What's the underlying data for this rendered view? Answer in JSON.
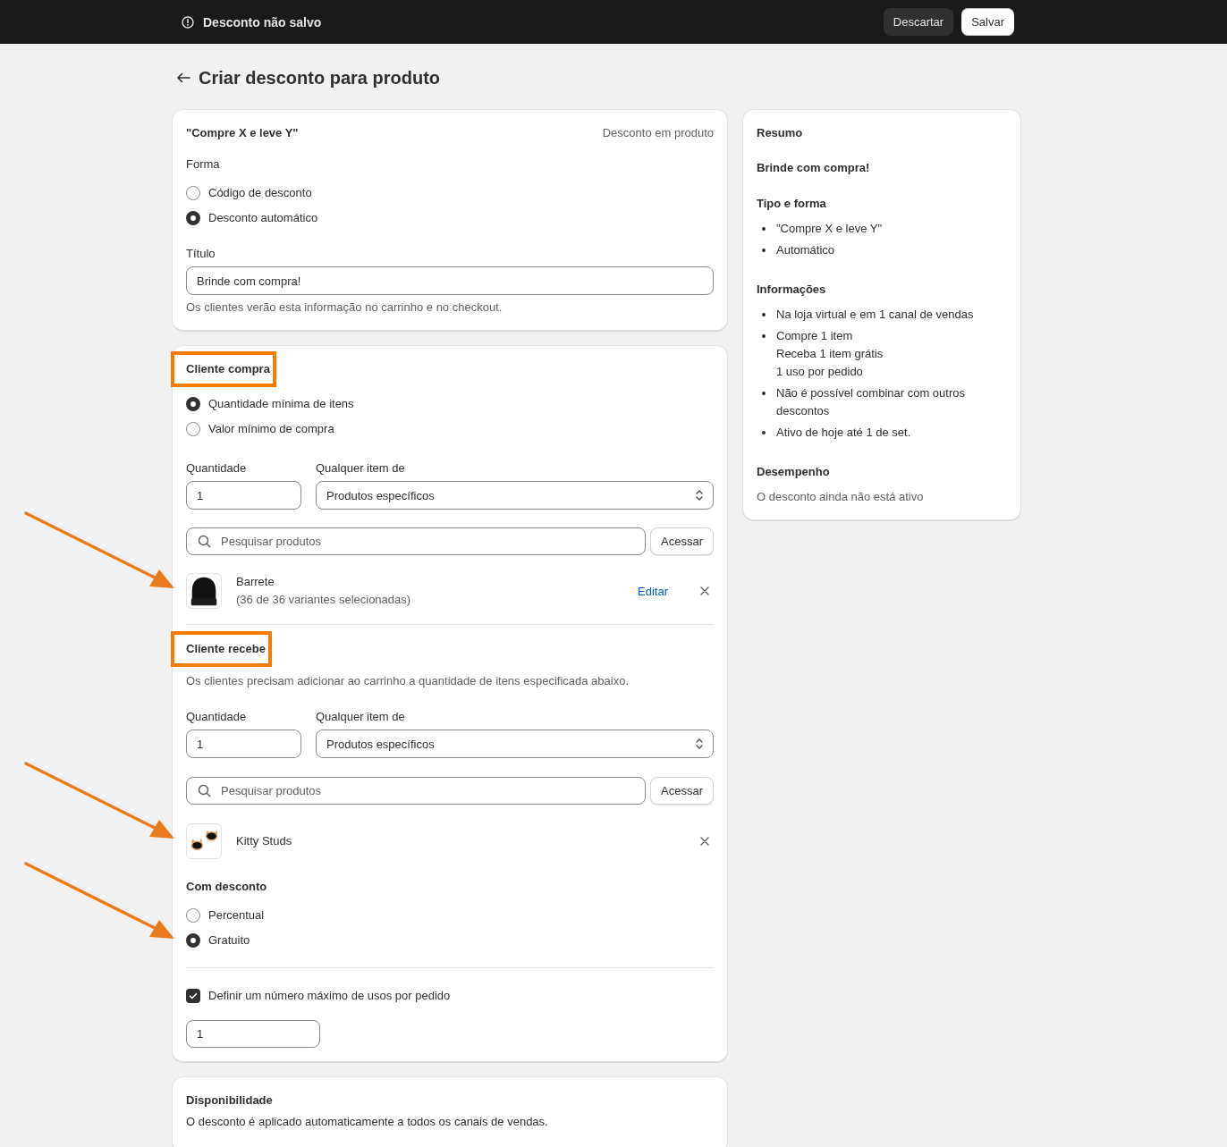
{
  "top_bar": {
    "status": "Desconto não salvo",
    "buttons": [
      {
        "label": "Descartar",
        "kind": "secondary"
      },
      {
        "label": "Salvar",
        "kind": "primary"
      }
    ]
  },
  "page": {
    "title": "Criar desconto para produto"
  },
  "type_card": {
    "title": "\"Compre X e leve Y\"",
    "type_label": "Desconto em produto",
    "method": {
      "label": "Forma",
      "options": [
        {
          "label": "Código de desconto",
          "selected": false
        },
        {
          "label": "Desconto automático",
          "selected": true
        }
      ]
    },
    "title_field": {
      "label": "Título",
      "value": "Brinde com compra!",
      "help": "Os clientes verão esta informação no carrinho e no checkout."
    }
  },
  "rules_card": {
    "buys": {
      "heading": "Cliente compra",
      "highlighted": true,
      "options": [
        {
          "label": "Quantidade mínima de itens",
          "selected": true
        },
        {
          "label": "Valor mínimo de compra",
          "selected": false
        }
      ],
      "quantity": {
        "label": "Quantidade",
        "value": "1"
      },
      "any_item": {
        "label": "Qualquer item de",
        "value": "Produtos específicos"
      },
      "search": {
        "placeholder": "Pesquisar produtos",
        "button": "Acessar"
      },
      "products": [
        {
          "name": "Barrete",
          "detail": "(36 de 36 variantes selecionadas)",
          "edit": "Editar",
          "kind": "beanie",
          "arrow": true
        }
      ]
    },
    "gets": {
      "heading": "Cliente recebe",
      "highlighted": true,
      "description": "Os clientes precisam adicionar ao carrinho a quantidade de itens especificada abaixo.",
      "quantity": {
        "label": "Quantidade",
        "value": "1"
      },
      "any_item": {
        "label": "Qualquer item de",
        "value": "Produtos específicos"
      },
      "search": {
        "placeholder": "Pesquisar produtos",
        "button": "Acessar"
      },
      "products": [
        {
          "name": "Kitty Studs",
          "kind": "earrings",
          "arrow": true
        }
      ],
      "discount": {
        "label": "Com desconto",
        "options": [
          {
            "label": "Percentual",
            "selected": false,
            "arrow": false
          },
          {
            "label": "Gratuito",
            "selected": true,
            "arrow": true
          }
        ]
      }
    },
    "max_uses": {
      "label": "Definir um número máximo de usos por pedido",
      "checked": true,
      "value": "1"
    }
  },
  "availability": {
    "title": "Disponibilidade",
    "text": "O desconto é aplicado automaticamente a todos os canais de vendas."
  },
  "summary": {
    "title": "Resumo",
    "discount_title": "Brinde com compra!",
    "sections": [
      {
        "heading": "Tipo e forma",
        "items": [
          {
            "lines": [
              "\"Compre X e leve Y\""
            ]
          },
          {
            "lines": [
              "Automático"
            ]
          }
        ]
      },
      {
        "heading": "Informações",
        "items": [
          {
            "lines": [
              "Na loja virtual e em 1 canal de vendas"
            ]
          },
          {
            "lines": [
              "Compre 1 item",
              "Receba 1 item grátis",
              "1 uso por pedido"
            ]
          },
          {
            "lines": [
              "Não é possível combinar com outros descontos"
            ]
          },
          {
            "lines": [
              "Ativo de hoje até 1 de set."
            ]
          }
        ]
      },
      {
        "heading": "Desempenho",
        "text": "O desconto ainda não está ativo"
      }
    ]
  }
}
